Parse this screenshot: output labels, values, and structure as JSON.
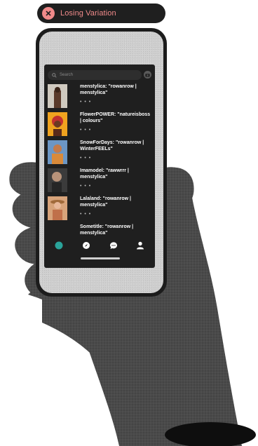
{
  "badge": {
    "label": "Losing Variation",
    "icon": "close-icon",
    "color": "#f08a8a"
  },
  "search": {
    "placeholder": "Search"
  },
  "feed": [
    {
      "username": "menstylica",
      "caption": "menstylica: \"rowanrow | menstylica\"",
      "more": "• • •"
    },
    {
      "username": "FlowerPOWER",
      "caption": "FlowerPOWER: \"natureisboss | colours\"",
      "more": "• • •"
    },
    {
      "username": "SnowForDays",
      "caption": "SnowForDays: \"rowanrow | WinterFEELs\"",
      "more": "• • •"
    },
    {
      "username": "Imamodel",
      "caption": "Imamodel: \"rawwrrr | menstylica\"",
      "more": "• • •"
    },
    {
      "username": "Lalaland",
      "caption": "Lalaland: \"rowanrow | menstylica\"",
      "more": "• • •"
    },
    {
      "username": "Sometitle",
      "caption": "Sometitle: \"rowanrow | menstylica\"",
      "more": ""
    }
  ],
  "tabs": [
    "home-dot-icon",
    "compass-icon",
    "chat-icon",
    "profile-icon"
  ],
  "colors": {
    "accent": "#2aa39a",
    "screen": "#1f1f1f"
  }
}
